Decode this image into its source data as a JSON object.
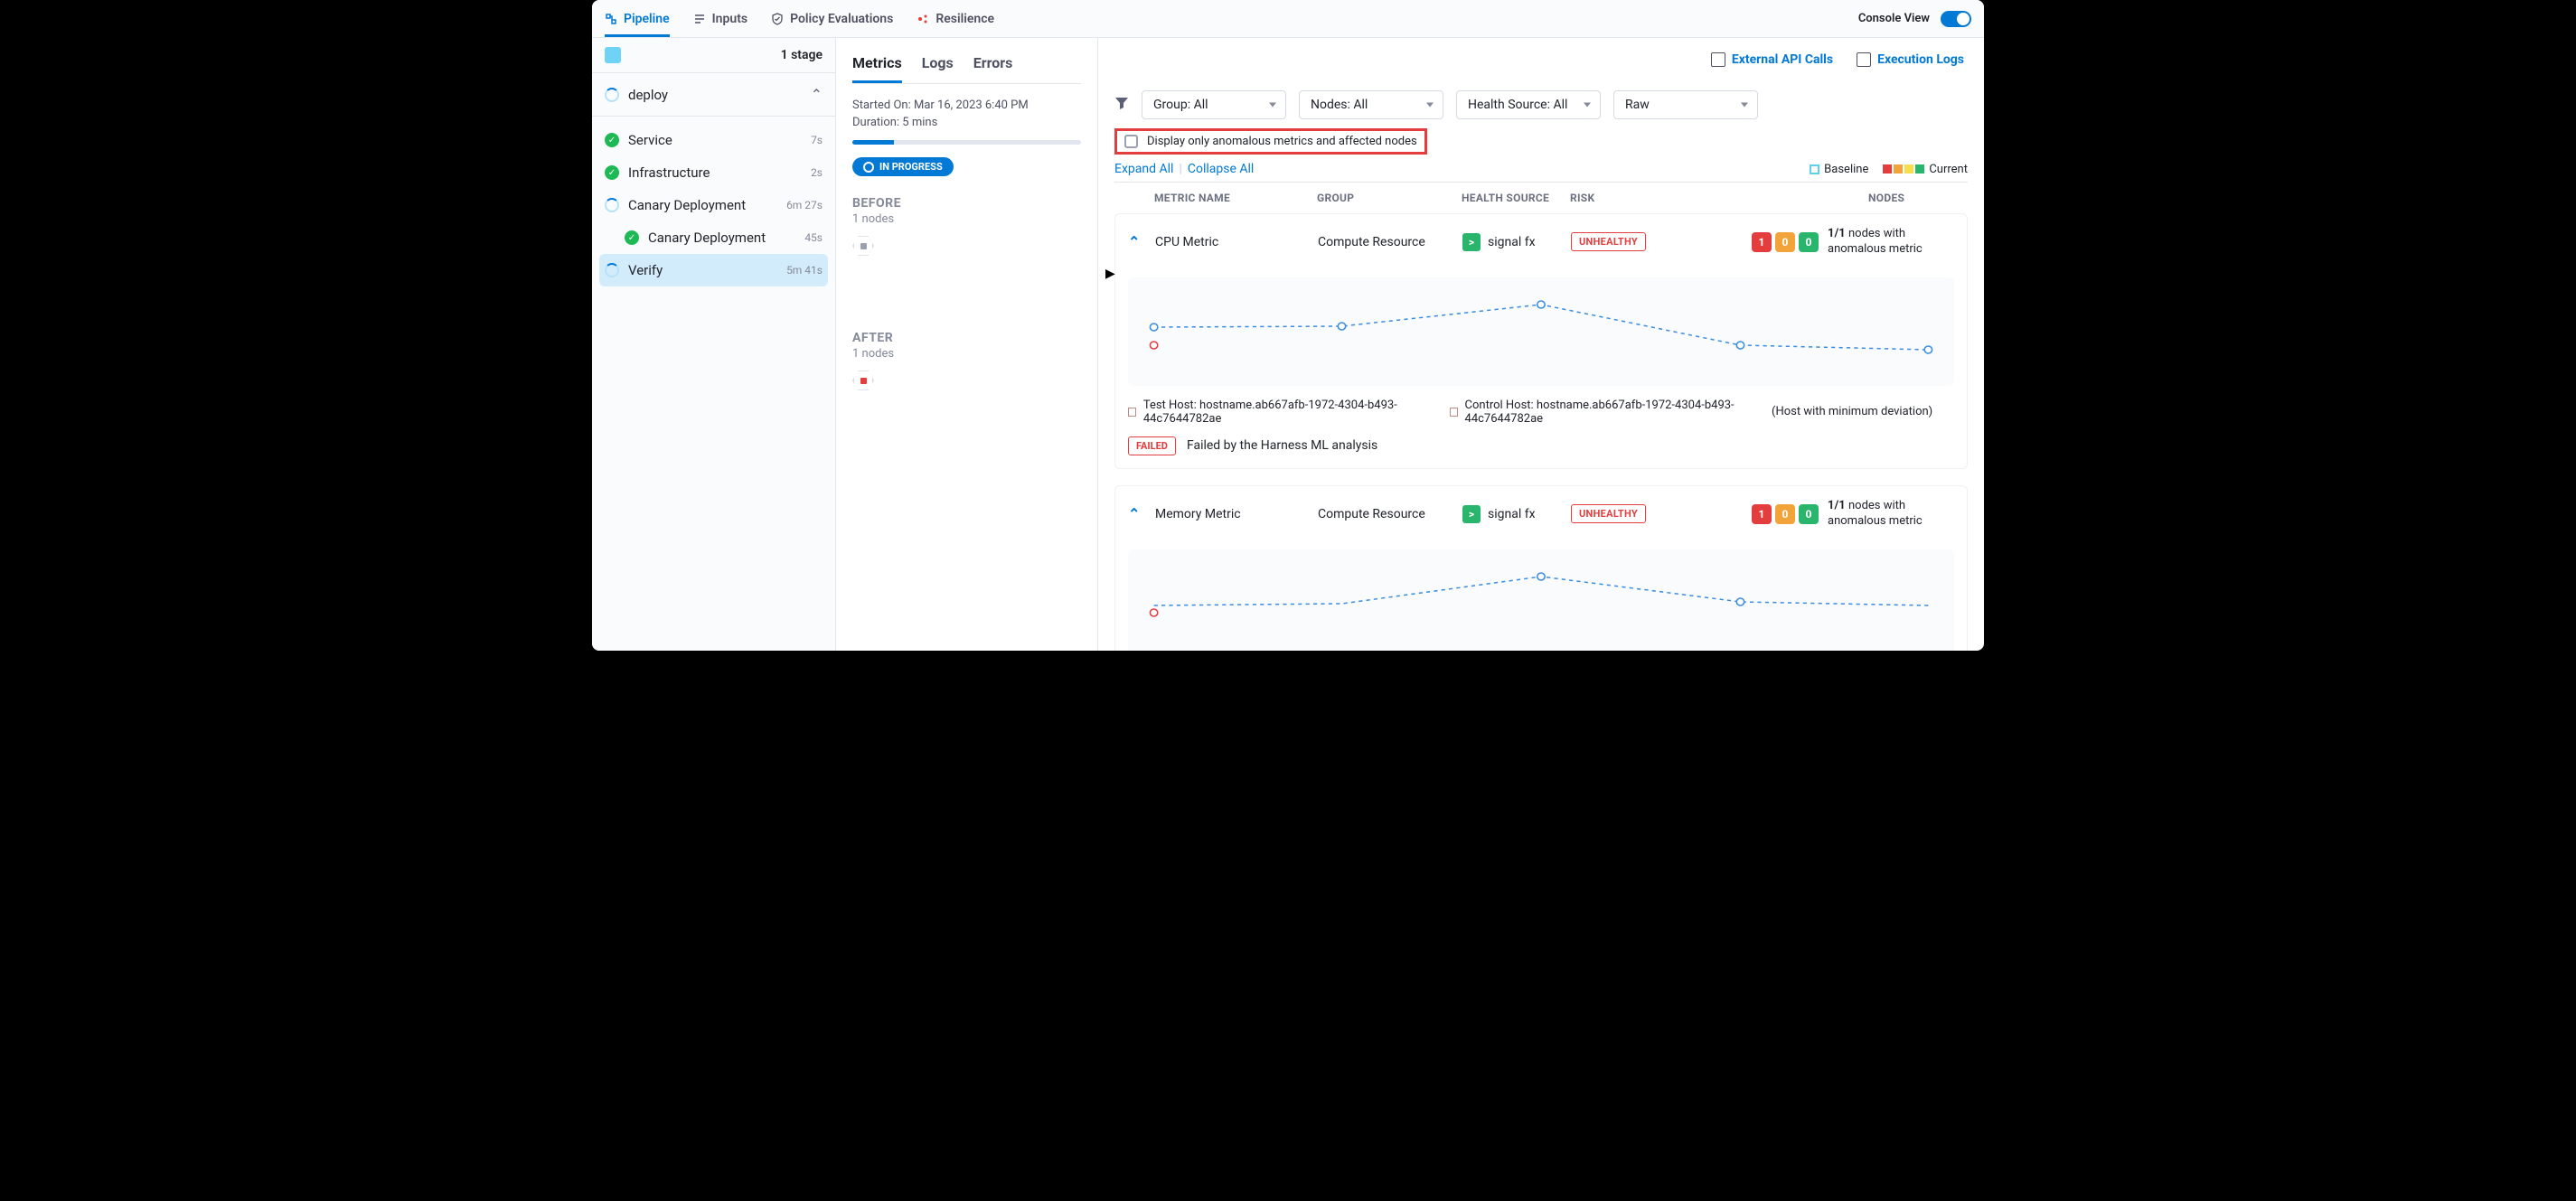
{
  "topTabs": {
    "pipeline": "Pipeline",
    "inputs": "Inputs",
    "policy": "Policy Evaluations",
    "resilience": "Resilience"
  },
  "consoleView": "Console View",
  "sidebar": {
    "stageCount": "1 stage",
    "deploy": "deploy",
    "steps": {
      "service": {
        "label": "Service",
        "dur": "7s"
      },
      "infra": {
        "label": "Infrastructure",
        "dur": "2s"
      },
      "canary": {
        "label": "Canary Deployment",
        "dur": "6m 27s"
      },
      "canary2": {
        "label": "Canary Deployment",
        "dur": "45s"
      },
      "verify": {
        "label": "Verify",
        "dur": "5m 41s"
      }
    }
  },
  "secTabs": {
    "metrics": "Metrics",
    "logs": "Logs",
    "errors": "Errors"
  },
  "meta": {
    "started": "Started On: Mar 16, 2023 6:40 PM",
    "duration": "Duration: 5 mins",
    "badge": "IN PROGRESS",
    "before": "BEFORE",
    "beforeNodes": "1 nodes",
    "after": "AFTER",
    "afterNodes": "1 nodes"
  },
  "topLinks": {
    "api": "External API Calls",
    "logs": "Execution Logs"
  },
  "filters": {
    "group": "Group: All",
    "nodes": "Nodes: All",
    "health": "Health Source: All",
    "raw": "Raw"
  },
  "anomalous": "Display only anomalous metrics and affected nodes",
  "expand": {
    "expand": "Expand All",
    "collapse": "Collapse All"
  },
  "legend": {
    "baseline": "Baseline",
    "current": "Current"
  },
  "tableHead": {
    "metricName": "METRIC NAME",
    "group": "GROUP",
    "healthSource": "HEALTH SOURCE",
    "risk": "RISK",
    "nodes": "NODES"
  },
  "metrics": [
    {
      "name": "CPU Metric",
      "group": "Compute Resource",
      "hs": "signal fx",
      "risk": "UNHEALTHY",
      "counts": {
        "red": "1",
        "orange": "0",
        "green": "0"
      },
      "nodesText": {
        "bold": "1/1",
        "rest": "nodes with anomalous metric"
      },
      "testHost": "Test Host: hostname.ab667afb-1972-4304-b493-44c7644782ae",
      "controlHost": "Control Host: hostname.ab667afb-1972-4304-b493-44c7644782ae",
      "minDev": "(Host with minimum deviation)",
      "failBadge": "FAILED",
      "failText": "Failed by the Harness ML analysis"
    },
    {
      "name": "Memory Metric",
      "group": "Compute Resource",
      "hs": "signal fx",
      "risk": "UNHEALTHY",
      "counts": {
        "red": "1",
        "orange": "0",
        "green": "0"
      },
      "nodesText": {
        "bold": "1/1",
        "rest": "nodes with anomalous metric"
      }
    }
  ],
  "chart_data": [
    {
      "type": "line",
      "title": "CPU Metric",
      "x": [
        0,
        1,
        2,
        3,
        4
      ],
      "series": [
        {
          "name": "Baseline",
          "values": [
            34,
            34,
            40,
            35,
            30
          ],
          "style": "dashed"
        },
        {
          "name": "Current",
          "values": [
            30
          ],
          "color": "#e43d3d"
        }
      ],
      "ylim": [
        0,
        50
      ]
    },
    {
      "type": "line",
      "title": "Memory Metric",
      "x": [
        0,
        1,
        2,
        3,
        4
      ],
      "series": [
        {
          "name": "Baseline",
          "values": [
            33,
            33,
            40,
            35,
            30
          ],
          "style": "dashed"
        },
        {
          "name": "Current",
          "values": [
            30
          ],
          "color": "#e43d3d"
        }
      ],
      "ylim": [
        0,
        50
      ]
    }
  ]
}
